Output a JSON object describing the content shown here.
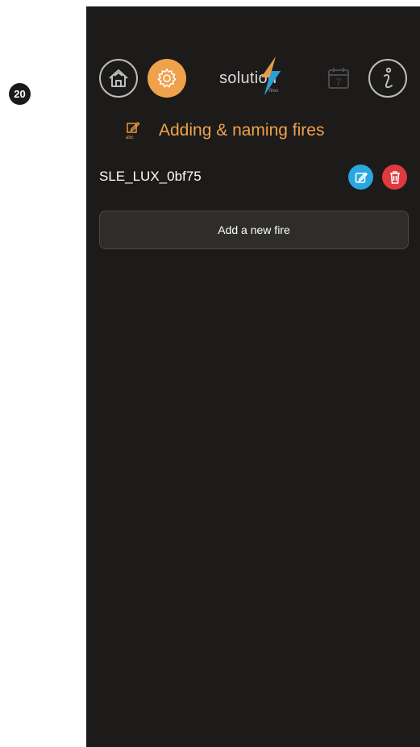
{
  "step_badge": "20",
  "header": {
    "logo_text": "solution",
    "logo_sub": "fires",
    "calendar_day": "7"
  },
  "section": {
    "title": "Adding & naming fires",
    "icon_sub": "abc"
  },
  "fires": [
    {
      "name": "SLE_LUX_0bf75"
    }
  ],
  "actions": {
    "add_label": "Add a new fire"
  },
  "colors": {
    "background": "#1c1b1a",
    "accent": "#f0a14b",
    "edit": "#29a8e0",
    "delete": "#e0393e"
  }
}
